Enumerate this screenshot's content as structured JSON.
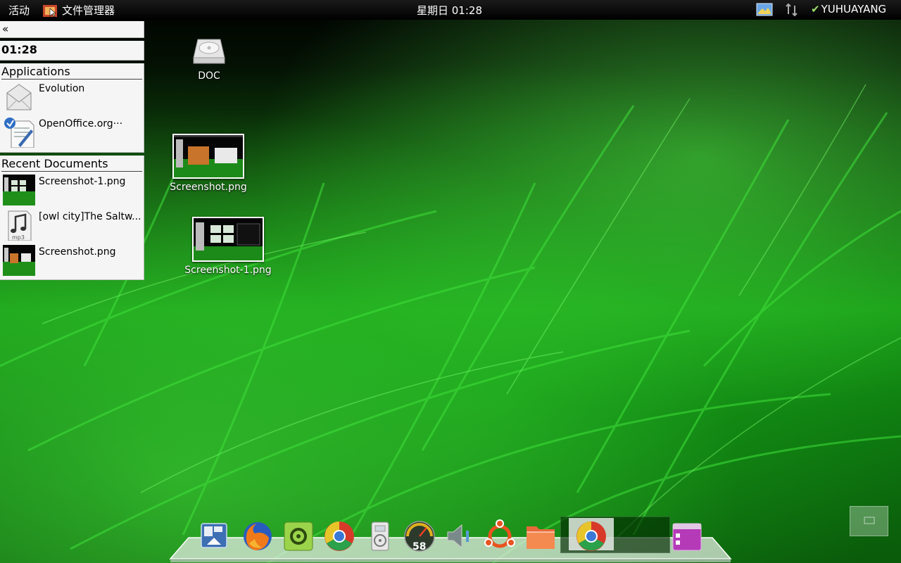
{
  "topbar": {
    "activities": "活动",
    "app_name": "文件管理器",
    "clock": "星期日 01:28",
    "user": "YUHUAYANG",
    "tray_icons": [
      "display-icon",
      "network-arrows-icon"
    ]
  },
  "panel": {
    "collapse_label": "«",
    "time": "01:28",
    "applications": {
      "title": "Applications",
      "items": [
        {
          "label": "Evolution",
          "icon": "mail-envelope-icon"
        },
        {
          "label": "OpenOffice.org···",
          "icon": "writer-document-icon"
        }
      ]
    },
    "recent": {
      "title": "Recent Documents",
      "items": [
        {
          "label": "Screenshot-1.png",
          "icon": "image-thumbnail-icon"
        },
        {
          "label": "[owl city]The Saltw...",
          "icon": "mp3-file-icon",
          "badge": "mp3"
        },
        {
          "label": "Screenshot.png",
          "icon": "image-thumbnail-icon"
        }
      ]
    }
  },
  "desktop": {
    "icons": [
      {
        "label": "DOC",
        "icon": "drive-icon"
      },
      {
        "label": "Screenshot.png",
        "icon": "image-thumbnail-icon"
      },
      {
        "label": "Screenshot-1.png",
        "icon": "image-thumbnail-icon"
      }
    ]
  },
  "dock": {
    "items": [
      {
        "icon": "show-desktop-icon"
      },
      {
        "icon": "firefox-icon"
      },
      {
        "icon": "system-settings-icon"
      },
      {
        "icon": "chrome-icon"
      },
      {
        "icon": "media-player-icon"
      },
      {
        "icon": "system-monitor-icon",
        "badge": "58"
      },
      {
        "icon": "volume-icon"
      },
      {
        "icon": "ubuntu-icon"
      },
      {
        "icon": "folder-icon"
      },
      {
        "icon": "chrome-window-icon"
      },
      {
        "icon": "terminal-app-icon"
      }
    ]
  },
  "colors": {
    "topbar_bg": "#000000",
    "panel_bg": "#f5f5f5",
    "grass_green": "#1aa01a"
  }
}
